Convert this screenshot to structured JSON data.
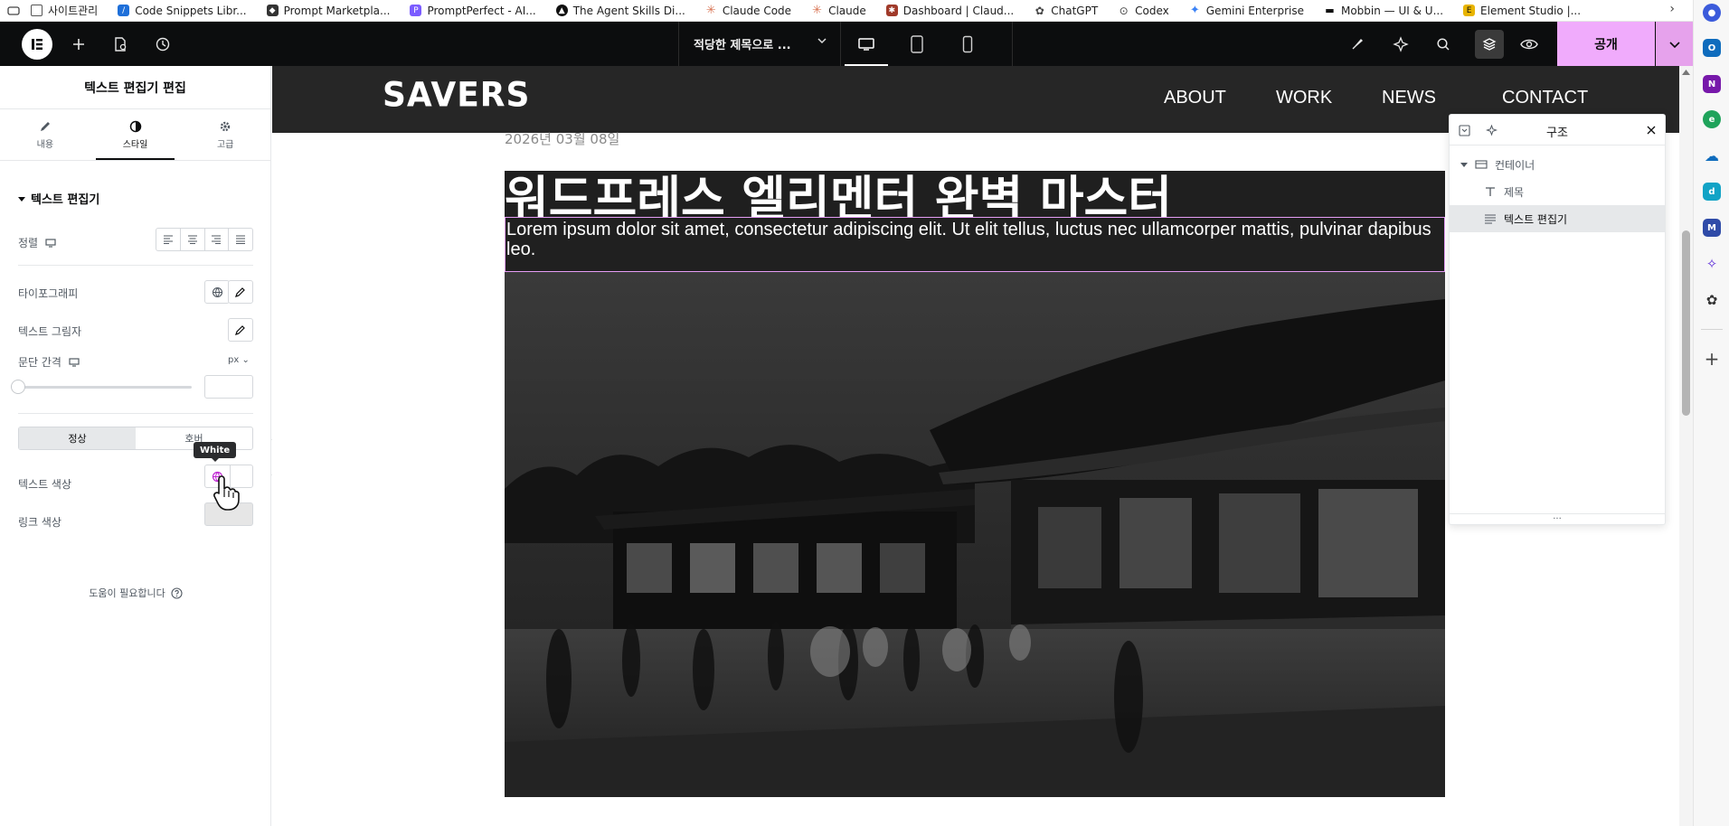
{
  "bookmarks": [
    {
      "label": "사이트관리",
      "color": "#6b6b6b"
    },
    {
      "label": "Code Snippets Libr...",
      "color": "#1e6fd9"
    },
    {
      "label": "Prompt Marketpla...",
      "color": "#333333"
    },
    {
      "label": "PromptPerfect - AI...",
      "color": "#7b5cff"
    },
    {
      "label": "The Agent Skills Di...",
      "color": "#111111"
    },
    {
      "label": "Claude Code",
      "color": "#d97757"
    },
    {
      "label": "Claude",
      "color": "#d97757"
    },
    {
      "label": "Dashboard | Claud...",
      "color": "#a03a2a"
    },
    {
      "label": "ChatGPT",
      "color": "#444444"
    },
    {
      "label": "Codex",
      "color": "#444444"
    },
    {
      "label": "Gemini Enterprise",
      "color": "#3b82f6"
    },
    {
      "label": "Mobbin — UI & U...",
      "color": "#111111"
    },
    {
      "label": "Element Studio |...",
      "color": "#e8b400"
    }
  ],
  "topbar": {
    "page_title": "적당한 제목으로 ...",
    "publish_label": "공개"
  },
  "panel": {
    "title": "텍스트 편집기 편집",
    "tabs": [
      {
        "label": "내용",
        "icon": "pencil-icon"
      },
      {
        "label": "스타일",
        "icon": "contrast-icon"
      },
      {
        "label": "고급",
        "icon": "gear-icon"
      }
    ],
    "section_title": "텍스트 편집기",
    "alignment_label": "정렬",
    "typography_label": "타이포그래피",
    "text_shadow_label": "텍스트 그림자",
    "paragraph_spacing_label": "문단 간격",
    "unit": "px",
    "state_normal": "정상",
    "state_hover": "호버",
    "text_color_label": "텍스트 색상",
    "link_color_label": "링크 색상",
    "tooltip": "White",
    "help_label": "도움이 필요합니다"
  },
  "site": {
    "logo": "SAVERS",
    "nav": [
      "ABOUT",
      "WORK",
      "NEWS",
      "CONTACT"
    ],
    "date": "2026년 03월 08일",
    "heading": "워드프레스 엘리멘터 완벽 마스터",
    "body": "Lorem ipsum dolor sit amet, consectetur adipiscing elit. Ut elit tellus, luctus nec ullamcorper mattis, pulvinar dapibus leo."
  },
  "structure": {
    "title": "구조",
    "items": [
      {
        "label": "컨테이너",
        "icon": "container-icon"
      },
      {
        "label": "제목",
        "icon": "heading-icon"
      },
      {
        "label": "텍스트 편집기",
        "icon": "text-editor-icon"
      }
    ],
    "footer": "..."
  },
  "colors": {
    "accent": "#f0abfc",
    "topbar": "#0c0d0e",
    "selection_border": "#e59cf5"
  }
}
